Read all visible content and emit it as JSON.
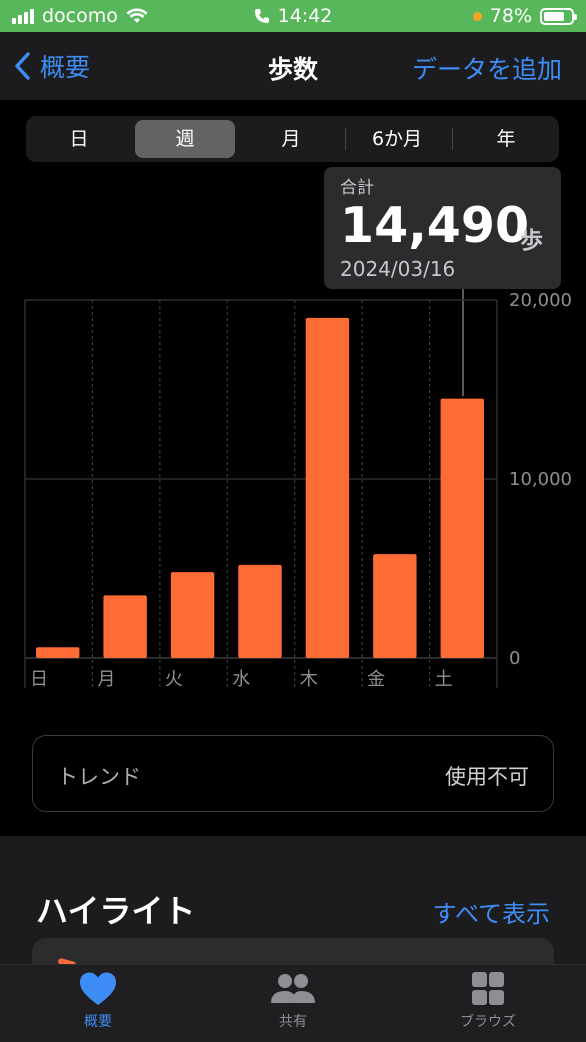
{
  "status": {
    "carrier": "docomo",
    "time": "14:42",
    "battery": "78%",
    "battery_level": 0.78
  },
  "nav": {
    "back_label": "概要",
    "title": "歩数",
    "action_label": "データを追加"
  },
  "periods": [
    "日",
    "週",
    "月",
    "6か月",
    "年"
  ],
  "selected_period": "週",
  "callout": {
    "label": "合計",
    "value": "14,490",
    "unit": "歩",
    "date": "2024/03/16"
  },
  "chart_data": {
    "type": "bar",
    "categories": [
      "日",
      "月",
      "火",
      "水",
      "木",
      "金",
      "土"
    ],
    "values": [
      600,
      3500,
      4800,
      5200,
      19000,
      5800,
      14490
    ],
    "ylim": [
      0,
      20000
    ],
    "y_ticks": [
      "0",
      "10,000",
      "20,000"
    ],
    "grid": true,
    "bar_color": "#ff6b35"
  },
  "trend": {
    "label": "トレンド",
    "value": "使用不可"
  },
  "highlights": {
    "title": "ハイライト",
    "see_all": "すべて表示"
  },
  "tabs": [
    {
      "label": "概要",
      "icon": "heart-icon",
      "active": true
    },
    {
      "label": "共有",
      "icon": "people-icon",
      "active": false
    },
    {
      "label": "ブラウズ",
      "icon": "grid-icon",
      "active": false
    }
  ],
  "colors": {
    "accent": "#3e8df6",
    "status_bar": "#58b75a",
    "bar": "#ff6b35"
  }
}
